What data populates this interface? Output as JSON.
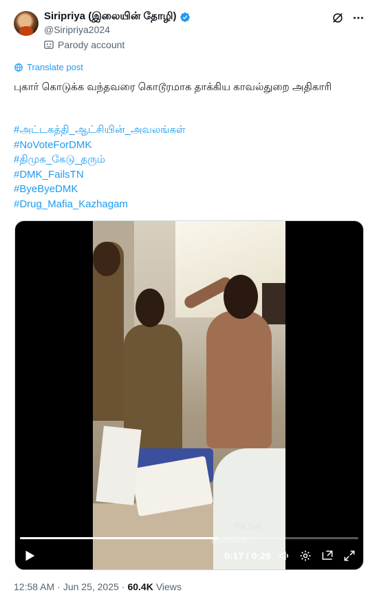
{
  "author": {
    "display_name": "Siripriya (இலையின் தோழி)",
    "handle": "@Siripriya2024",
    "account_label": "Parody account",
    "verified": true
  },
  "actions": {
    "grok_icon": "grok-icon",
    "more_icon": "more-icon"
  },
  "translate_label": "Translate post",
  "post_text": "புகார் கொடுக்க வந்தவரை கொடூரமாக தாக்கிய காவல்துறை அதிகாரி",
  "hashtags": [
    "#அட்டகத்தி_ஆட்சியின்_அவலங்கள்",
    "#NoVoteForDMK",
    "#திமுக_கேடு_தரும்",
    "#DMK_FailsTN",
    "#ByeByeDMK",
    "#Drug_Mafia_Kazhagam"
  ],
  "video": {
    "time_display": "0:17 / 0:29",
    "progress": 0.586,
    "watermark": "TikTok",
    "watermark_handle": "@satishkumar..."
  },
  "meta": {
    "time": "12:58 AM",
    "separator": "·",
    "date": "Jun 25, 2025",
    "views_count": "60.4K",
    "views_label": "Views"
  },
  "colors": {
    "accent": "#1d9bf0",
    "secondary_text": "#536471",
    "primary_text": "#0f1419"
  }
}
